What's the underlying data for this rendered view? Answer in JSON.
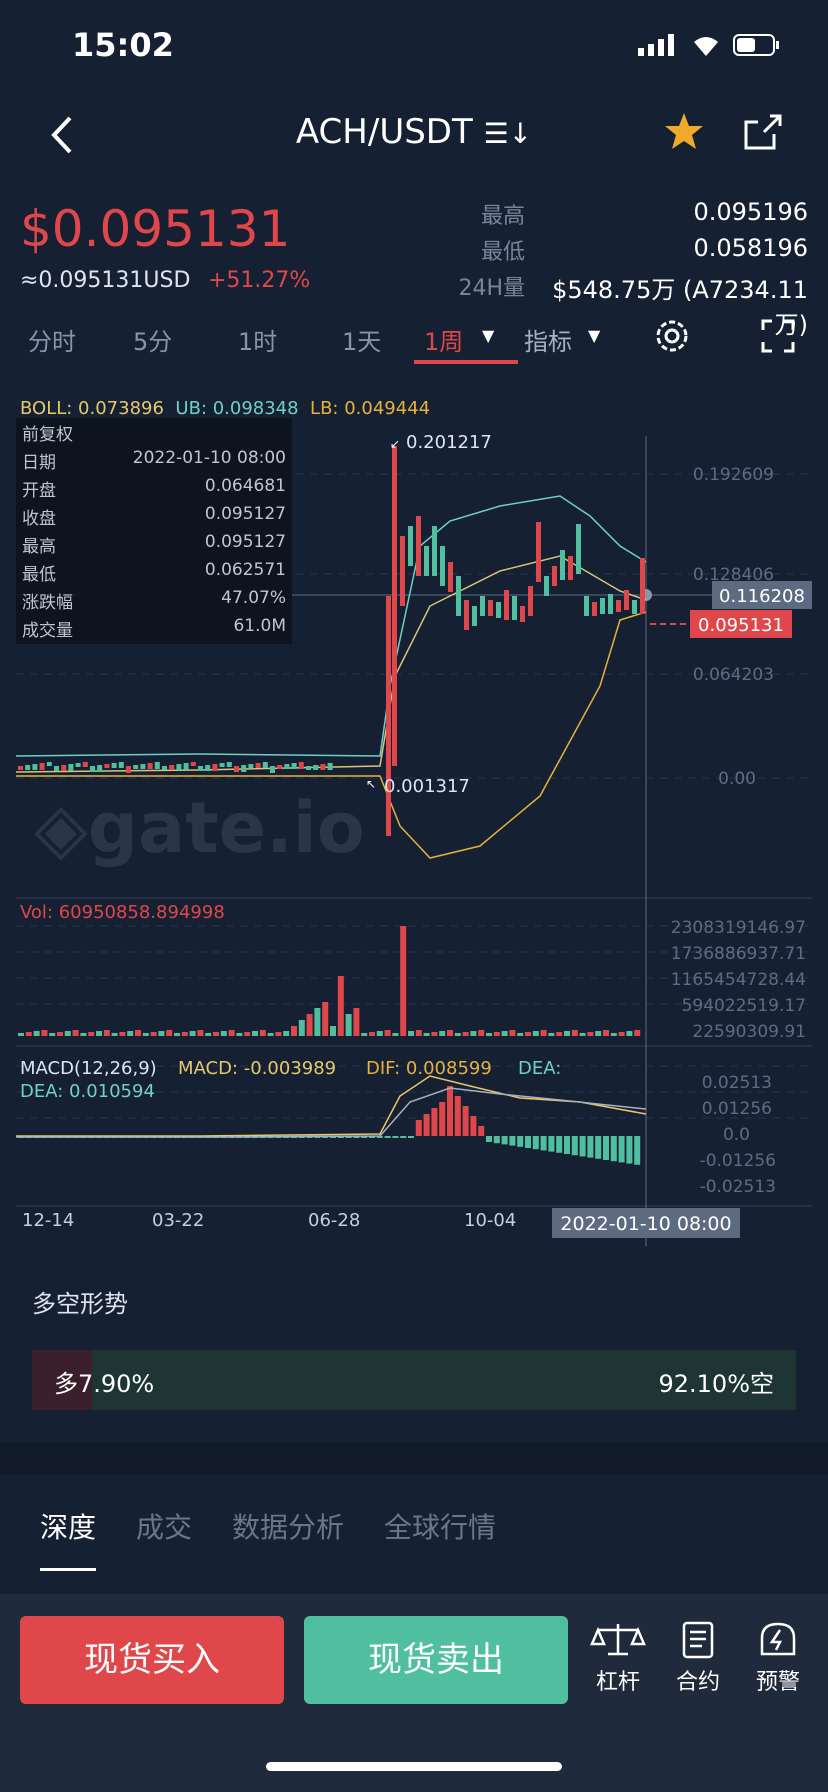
{
  "status_bar": {
    "time": "15:02"
  },
  "header": {
    "title": "ACH/USDT",
    "swap_icon": "swap-icon",
    "favorite_icon": "star-icon",
    "share_icon": "share-icon"
  },
  "ticker": {
    "price": "$0.095131",
    "usd": "≈0.095131USD",
    "change": "+51.27%",
    "high_label": "最高",
    "high": "0.095196",
    "low_label": "最低",
    "low": "0.058196",
    "vol_label": "24H量",
    "vol": "$548.75万 (A7234.11万)"
  },
  "tabs": [
    {
      "label": "分时"
    },
    {
      "label": "5分"
    },
    {
      "label": "1时"
    },
    {
      "label": "1天"
    },
    {
      "label": "1周"
    },
    {
      "label": "指标"
    }
  ],
  "boll": {
    "boll": "BOLL: 0.073896",
    "ub": "UB: 0.098348",
    "lb": "LB: 0.049444"
  },
  "info": {
    "title": "前复权",
    "rows": [
      {
        "k": "日期",
        "v": "2022-01-10 08:00"
      },
      {
        "k": "开盘",
        "v": "0.064681"
      },
      {
        "k": "收盘",
        "v": "0.095127"
      },
      {
        "k": "最高",
        "v": "0.095127"
      },
      {
        "k": "最低",
        "v": "0.062571"
      },
      {
        "k": "涨跌幅",
        "v": "47.07%"
      },
      {
        "k": "成交量",
        "v": "61.0M"
      }
    ]
  },
  "chart": {
    "high_mark": "0.201217",
    "low_mark": "0.001317",
    "price_axis": [
      "0.192609",
      "0.128406",
      "0.064203",
      "0.00"
    ],
    "cross_value": "0.116208",
    "last_price": "0.095131",
    "vol_label": "Vol: 60950858.894998",
    "vol_axis": [
      "2308319146.97",
      "1736886937.71",
      "1165454728.44",
      "594022519.17",
      "22590309.91"
    ],
    "macd_label": "MACD(12,26,9)",
    "macd_val": "MACD: -0.003989",
    "dif_val": "DIF: 0.008599",
    "dea_val": "DEA: 0.010594",
    "macd_axis": [
      "0.02513",
      "0.01256",
      "0.0",
      "-0.01256",
      "-0.02513"
    ],
    "dates": [
      "12-14",
      "03-22",
      "06-28",
      "10-04"
    ],
    "cross_date": "2022-01-10 08:00",
    "watermark": "gate.io"
  },
  "long_short": {
    "title": "多空形势",
    "long": "多7.90%",
    "short": "92.10%空",
    "long_fraction": 0.079
  },
  "bottom_tabs": [
    {
      "label": "深度"
    },
    {
      "label": "成交"
    },
    {
      "label": "数据分析"
    },
    {
      "label": "全球行情"
    }
  ],
  "actions": {
    "buy": "现货买入",
    "sell": "现货卖出",
    "leverage": "杠杆",
    "contract": "合约",
    "alert": "预警"
  },
  "colors": {
    "up": "#e0474a",
    "down": "#4fbf9f",
    "bg": "#162033"
  },
  "chart_data": {
    "type": "candlestick",
    "title": "ACH/USDT 1周",
    "x": [
      "12-14",
      "03-22",
      "06-28",
      "10-04",
      "2022-01-10"
    ],
    "series": [
      {
        "name": "BOLL",
        "values": [
          0.073896
        ]
      },
      {
        "name": "UB",
        "values": [
          0.098348
        ]
      },
      {
        "name": "LB",
        "values": [
          0.049444
        ]
      }
    ],
    "ylim": [
      0,
      0.201217
    ],
    "grid": true
  }
}
